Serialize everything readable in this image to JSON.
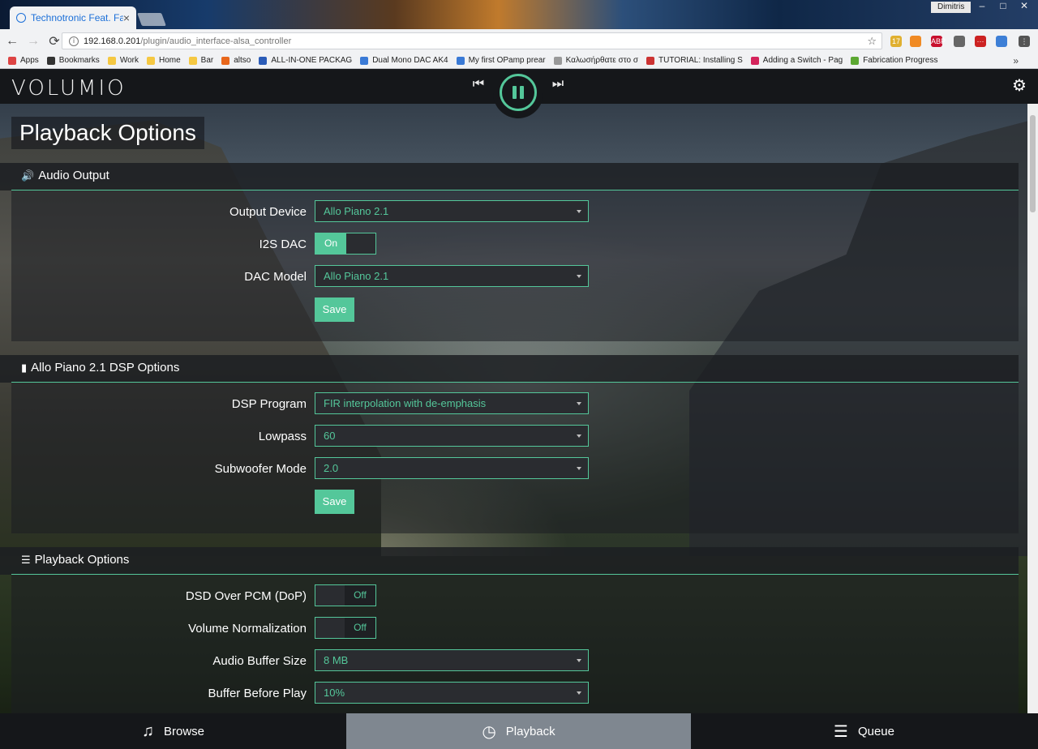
{
  "browser": {
    "tab_title": "Technotronic Feat. Fally",
    "tab_close": "×",
    "profile_name": "Dimitris",
    "window_controls": {
      "minimize": "–",
      "maximize": "□",
      "close": "✕"
    },
    "url_host": "192.168.0.201",
    "url_path": "/plugin/audio_interface-alsa_controller",
    "nav": {
      "back": "←",
      "forward": "→",
      "reload": "⟳"
    },
    "extensions": [
      {
        "icon": "weather-icon",
        "label": "17",
        "color": "#e0b030"
      },
      {
        "icon": "rss-icon",
        "label": "",
        "color": "#f08a24"
      },
      {
        "icon": "adblock-icon",
        "label": "ABP",
        "color": "#c8102e"
      },
      {
        "icon": "puzzle-icon",
        "label": "",
        "color": "#666666"
      },
      {
        "icon": "lastpass-icon",
        "label": "···",
        "color": "#cc2222"
      },
      {
        "icon": "dropbox-icon",
        "label": "",
        "color": "#3d7fd6"
      },
      {
        "icon": "menu-icon",
        "label": "⋮",
        "color": "#555555"
      }
    ],
    "bookmarks": [
      {
        "label": "Apps",
        "icon": "apps-icon",
        "color": "#d44"
      },
      {
        "label": "Bookmarks",
        "icon": "star-icon",
        "color": "#333"
      },
      {
        "label": "Work",
        "icon": "folder-icon",
        "color": "#f5c842"
      },
      {
        "label": "Home",
        "icon": "folder-icon",
        "color": "#f5c842"
      },
      {
        "label": "Bar",
        "icon": "folder-icon",
        "color": "#f5c842"
      },
      {
        "label": "altso",
        "icon": "site-icon",
        "color": "#e8671c"
      },
      {
        "label": "ALL-IN-ONE PACKAG",
        "icon": "site-icon",
        "color": "#2b5cb8"
      },
      {
        "label": "Dual Mono DAC AK4",
        "icon": "site-icon",
        "color": "#3a7ad6"
      },
      {
        "label": "My first OPamp prear",
        "icon": "site-icon",
        "color": "#3a7ad6"
      },
      {
        "label": "Καλωσήρθατε στο σ",
        "icon": "page-icon",
        "color": "#999"
      },
      {
        "label": "TUTORIAL: Installing S",
        "icon": "site-icon",
        "color": "#c33"
      },
      {
        "label": "Adding a Switch - Pag",
        "icon": "site-icon",
        "color": "#d4245c"
      },
      {
        "label": "Fabrication Progress",
        "icon": "site-icon",
        "color": "#5ca832"
      }
    ],
    "bookmarks_overflow": "»"
  },
  "app": {
    "logo": "VOLUMIO",
    "controls": {
      "prev": "⏮",
      "next": "⏭"
    },
    "settings_icon": "⚙",
    "accent_color": "#54c79a",
    "page_title": "Playback Options",
    "sections": {
      "audio_output": {
        "title": "Audio Output",
        "icon": "🔊",
        "output_device_label": "Output Device",
        "output_device_value": "Allo Piano 2.1",
        "i2s_label": "I2S DAC",
        "i2s_state": "On",
        "dac_model_label": "DAC Model",
        "dac_model_value": "Allo Piano 2.1",
        "save_label": "Save"
      },
      "dsp": {
        "title": "Allo Piano 2.1 DSP Options",
        "icon": "▮",
        "program_label": "DSP Program",
        "program_value": "FIR interpolation with de-emphasis",
        "lowpass_label": "Lowpass",
        "lowpass_value": "60",
        "subwoofer_label": "Subwoofer Mode",
        "subwoofer_value": "2.0",
        "save_label": "Save"
      },
      "playback": {
        "title": "Playback Options",
        "icon": "☰",
        "dop_label": "DSD Over PCM (DoP)",
        "dop_state": "Off",
        "norm_label": "Volume Normalization",
        "norm_state": "Off",
        "buffer_label": "Audio Buffer Size",
        "buffer_value": "8 MB",
        "before_play_label": "Buffer Before Play",
        "before_play_value": "10%"
      }
    },
    "bottom_nav": {
      "browse": "Browse",
      "playback": "Playback",
      "queue": "Queue"
    }
  }
}
